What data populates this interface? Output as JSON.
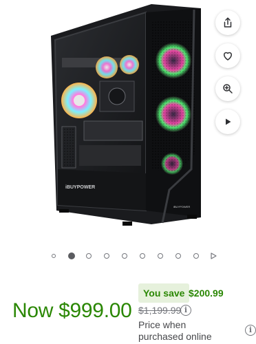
{
  "product": {
    "image_alt": "iBUYPOWER gaming desktop PC with RGB fans",
    "case_brand": "iBUYPOWER"
  },
  "actions": [
    {
      "name": "share",
      "icon": "share-icon"
    },
    {
      "name": "favorite",
      "icon": "heart-icon"
    },
    {
      "name": "zoom",
      "icon": "zoom-in-icon"
    },
    {
      "name": "play-video",
      "icon": "play-icon"
    }
  ],
  "carousel": {
    "total_items": 10,
    "active_index": 1,
    "has_video_item": true
  },
  "pricing": {
    "now_price": "Now $999.00",
    "you_save_label": "You save",
    "save_amount": "$200.99",
    "was_price": "$1,199.99",
    "price_note": "Price when purchased online",
    "info_icon_glyph": "i"
  },
  "colors": {
    "price_green": "#2a8703",
    "save_bg": "#e6f1dc"
  }
}
